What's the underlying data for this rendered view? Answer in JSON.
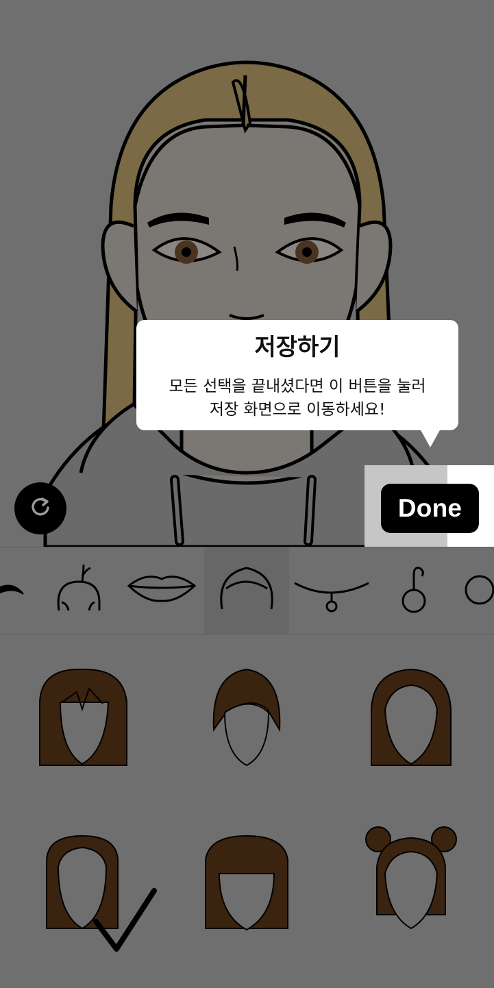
{
  "header": {
    "done_label": "Done"
  },
  "tooltip": {
    "title": "저장하기",
    "line1": "모든 선택을 끝내셨다면 이 버튼을 눌러",
    "line2": "저장 화면으로 이동하세요!"
  },
  "icons": {
    "reset": "rotate-reset-icon",
    "check": "checkmark-icon"
  },
  "category_tabs": [
    {
      "name": "eyebrow-tab",
      "icon": "eyebrow-icon"
    },
    {
      "name": "headband-tab",
      "icon": "antler-headband-icon"
    },
    {
      "name": "lips-tab",
      "icon": "lips-icon"
    },
    {
      "name": "hair-tab",
      "icon": "hair-icon",
      "selected": true
    },
    {
      "name": "necklace-tab",
      "icon": "necklace-icon"
    },
    {
      "name": "earring-tab",
      "icon": "hoop-earring-icon"
    },
    {
      "name": "ring-tab",
      "icon": "ring-icon"
    }
  ],
  "hair_options": [
    {
      "name": "hair-option-bob-bangs"
    },
    {
      "name": "hair-option-short-sidepart"
    },
    {
      "name": "hair-option-centerpart-medium"
    },
    {
      "name": "hair-option-centerpart-straight",
      "selected": true
    },
    {
      "name": "hair-option-blunt-bangs"
    },
    {
      "name": "hair-option-space-buns"
    }
  ],
  "colors": {
    "overlay_gray": "#6f6f6f",
    "hair_blonde": "#7a6a45",
    "hair_brown": "#3a230f",
    "skin_shadowed": "#7b7874",
    "hoodie": "#6a6a6a",
    "done_bg": "#000000",
    "tooltip_bg": "#ffffff"
  }
}
